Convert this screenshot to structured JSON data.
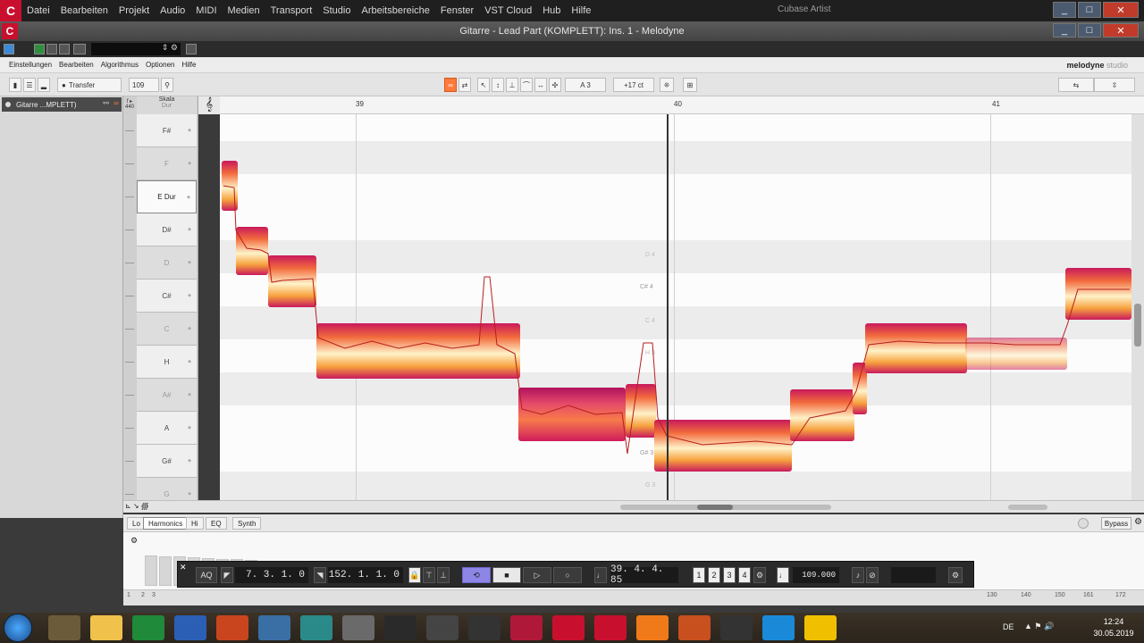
{
  "cubase": {
    "menu": [
      "Datei",
      "Bearbeiten",
      "Projekt",
      "Audio",
      "MIDI",
      "Medien",
      "Transport",
      "Studio",
      "Arbeitsbereiche",
      "Fenster",
      "VST Cloud",
      "Hub",
      "Hilfe"
    ],
    "app_title": "Cubase Artist",
    "plugin_title": "Gitarre - Lead Part (KOMPLETT): Ins. 1 - Melodyne"
  },
  "melodyne": {
    "menu": [
      "Einstellungen",
      "Bearbeiten",
      "Algorithmus",
      "Optionen",
      "Hilfe"
    ],
    "logo": "melodyne",
    "logo_edition": "studio",
    "toolbar": {
      "transfer_label": "Transfer",
      "tempo": "109",
      "pitch_note": "A 3",
      "cents": "+17 ct"
    },
    "track": {
      "name": "Gitarre ...MPLETT)"
    },
    "scale_header": {
      "label": "Skala",
      "mode": "Dur",
      "ref": "440"
    },
    "keys": [
      {
        "label": "F#",
        "style": "white"
      },
      {
        "label": "F",
        "style": "dark"
      },
      {
        "label": "E Dur",
        "style": "sel"
      },
      {
        "label": "D#",
        "style": "white"
      },
      {
        "label": "D",
        "style": "dark"
      },
      {
        "label": "C#",
        "style": "white"
      },
      {
        "label": "C",
        "style": "dark"
      },
      {
        "label": "H",
        "style": "white"
      },
      {
        "label": "A#",
        "style": "dark"
      },
      {
        "label": "A",
        "style": "white"
      },
      {
        "label": "G#",
        "style": "white"
      },
      {
        "label": "G",
        "style": "dark"
      }
    ],
    "ruler": {
      "bars": [
        "39",
        "40",
        "41"
      ]
    },
    "note_labels": [
      "D 4",
      "C# 4",
      "C 4",
      "H 3",
      "G# 3",
      "G 3"
    ],
    "lower_tabs": [
      "Lo",
      "Harmonics",
      "Hi",
      "EQ",
      "Synth"
    ],
    "bypass": "Bypass",
    "harmonic_numbers": [
      "1",
      "2",
      "3",
      "130",
      "140",
      "150",
      "161",
      "172"
    ]
  },
  "transport": {
    "aq": "AQ",
    "left_locator": "7. 3. 1.   0",
    "right_locator": "152. 1. 1.   0",
    "position": "39. 4. 4. 85",
    "tempo": "109.000",
    "markers": [
      "1",
      "2",
      "3",
      "4"
    ]
  },
  "taskbar": {
    "apps": [
      "explorer",
      "outlook",
      "excel",
      "word",
      "powerpoint",
      "app-2017",
      "app-film",
      "app-monster",
      "fx8",
      "app-bee",
      "app-circle",
      "cubase",
      "cubase-active",
      "melodyne",
      "ezd",
      "app-arrow",
      "v49",
      "app-q",
      "app-a"
    ],
    "language": "DE",
    "time": "12:24",
    "date": "30.05.2019"
  },
  "colors": {
    "blob_top": "#c91a5c",
    "blob_mid": "#fff2c8",
    "blob_orange": "#f26a3c",
    "accent_orange": "#ff7a3c",
    "loop_purple": "#8d86e6"
  }
}
